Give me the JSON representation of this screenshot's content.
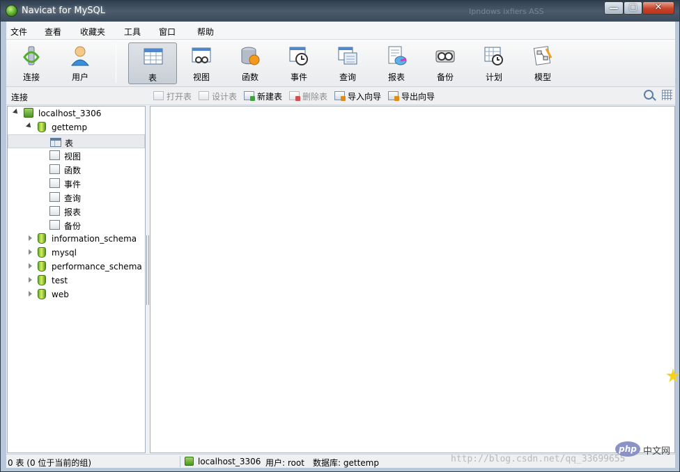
{
  "window": {
    "title": "Navicat for MySQL",
    "ghost_text": "Ipndows  ixfiers  ASS",
    "min_glyph": "—",
    "max_glyph": "▢",
    "close_glyph": "✕"
  },
  "menu": [
    "文件",
    "查看",
    "收藏夹",
    "工具",
    "窗口",
    "帮助"
  ],
  "toolbar": [
    {
      "label": "连接",
      "icon": "connection-icon"
    },
    {
      "label": "用户",
      "icon": "user-icon"
    },
    {
      "label": "表",
      "icon": "table-icon",
      "active": true
    },
    {
      "label": "视图",
      "icon": "view-icon"
    },
    {
      "label": "函数",
      "icon": "function-icon"
    },
    {
      "label": "事件",
      "icon": "event-icon"
    },
    {
      "label": "查询",
      "icon": "query-icon"
    },
    {
      "label": "报表",
      "icon": "report-icon"
    },
    {
      "label": "备份",
      "icon": "backup-icon"
    },
    {
      "label": "计划",
      "icon": "schedule-icon"
    },
    {
      "label": "模型",
      "icon": "model-icon"
    }
  ],
  "subbar": {
    "connection_label": "连接",
    "actions": [
      {
        "label": "打开表",
        "enabled": false
      },
      {
        "label": "设计表",
        "enabled": false
      },
      {
        "label": "新建表",
        "enabled": true
      },
      {
        "label": "删除表",
        "enabled": false
      },
      {
        "label": "导入向导",
        "enabled": true
      },
      {
        "label": "导出向导",
        "enabled": true
      }
    ]
  },
  "tree": {
    "connection": "localhost_3306",
    "open_db": "gettemp",
    "objects": [
      "表",
      "视图",
      "函数",
      "事件",
      "查询",
      "报表",
      "备份"
    ],
    "selected_object": "表",
    "other_dbs": [
      "information_schema",
      "mysql",
      "performance_schema",
      "test",
      "web"
    ]
  },
  "status": {
    "left": "0 表 (0 位于当前的组)",
    "server": "localhost_3306",
    "user": "用户: root",
    "database": "数据库: gettemp"
  },
  "overlay": {
    "watermark": "http://blog.csdn.net/qq_33699655",
    "php_logo": "php",
    "php_cn": "中文网"
  },
  "colors": {
    "title_bar": "#3a4a5b",
    "accent_green": "#52a82a",
    "close_button": "#c5442a"
  }
}
